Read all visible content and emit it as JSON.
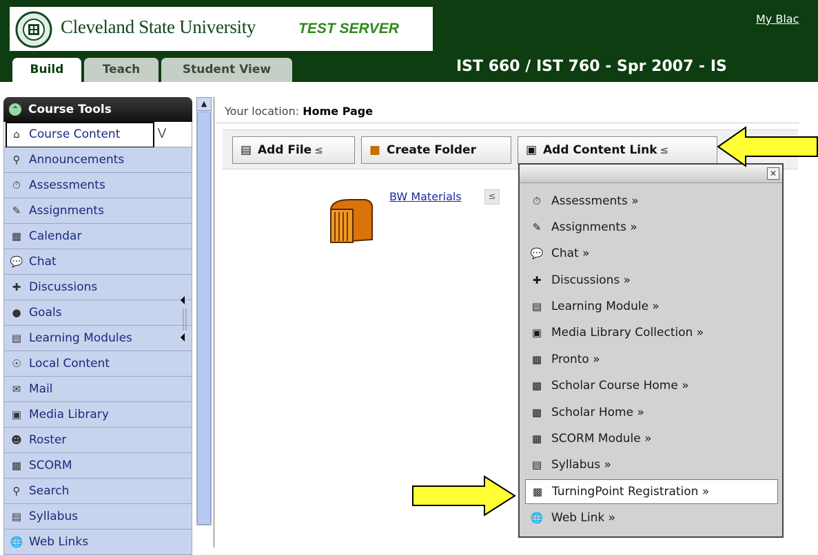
{
  "header": {
    "university": "Cleveland State University",
    "server_badge": "TEST SERVER",
    "top_link": "My Blac",
    "course_title": "IST 660 / IST 760 - Spr 2007 - IS",
    "tabs": [
      {
        "label": "Build",
        "active": true
      },
      {
        "label": "Teach",
        "active": false
      },
      {
        "label": "Student View",
        "active": false
      }
    ]
  },
  "sidebar": {
    "title": "Course Tools",
    "items": [
      {
        "label": "Course Content",
        "icon": "home-icon",
        "active": true
      },
      {
        "label": "Announcements",
        "icon": "megaphone-icon"
      },
      {
        "label": "Assessments",
        "icon": "stopwatch-icon"
      },
      {
        "label": "Assignments",
        "icon": "pencil-icon"
      },
      {
        "label": "Calendar",
        "icon": "calendar-icon"
      },
      {
        "label": "Chat",
        "icon": "speech-bubble-icon"
      },
      {
        "label": "Discussions",
        "icon": "pushpin-icon"
      },
      {
        "label": "Goals",
        "icon": "apple-icon"
      },
      {
        "label": "Learning Modules",
        "icon": "document-icon"
      },
      {
        "label": "Local Content",
        "icon": "disc-icon"
      },
      {
        "label": "Mail",
        "icon": "envelope-icon"
      },
      {
        "label": "Media Library",
        "icon": "media-icon"
      },
      {
        "label": "Roster",
        "icon": "people-icon"
      },
      {
        "label": "SCORM",
        "icon": "scorm-icon"
      },
      {
        "label": "Search",
        "icon": "magnifier-icon"
      },
      {
        "label": "Syllabus",
        "icon": "syllabus-icon"
      },
      {
        "label": "Web Links",
        "icon": "globe-icon"
      }
    ]
  },
  "main": {
    "location_label": "Your location:",
    "location_value": "Home Page",
    "buttons": {
      "add_file": "Add File",
      "create_folder": "Create Folder",
      "add_content_link": "Add Content Link"
    },
    "folder_link": "BW Materials"
  },
  "menu": {
    "items": [
      {
        "label": "Assessments »",
        "icon": "stopwatch-icon"
      },
      {
        "label": "Assignments »",
        "icon": "pencil-icon"
      },
      {
        "label": "Chat »",
        "icon": "speech-bubble-icon"
      },
      {
        "label": "Discussions »",
        "icon": "pushpin-icon"
      },
      {
        "label": "Learning Module »",
        "icon": "document-icon"
      },
      {
        "label": "Media Library Collection »",
        "icon": "media-icon"
      },
      {
        "label": "Pronto »",
        "icon": "plugin-icon"
      },
      {
        "label": "Scholar Course Home »",
        "icon": "plugin-icon"
      },
      {
        "label": "Scholar Home »",
        "icon": "plugin-icon"
      },
      {
        "label": "SCORM Module »",
        "icon": "scorm-icon"
      },
      {
        "label": "Syllabus »",
        "icon": "syllabus-icon"
      },
      {
        "label": "TurningPoint Registration »",
        "icon": "plugin-icon",
        "highlighted": true
      },
      {
        "label": "Web Link »",
        "icon": "globe-icon"
      }
    ]
  },
  "colors": {
    "header_bg": "#0d3d10",
    "sidebar_item_bg": "#c8d3ee",
    "arrow_fill": "#ffff33"
  }
}
